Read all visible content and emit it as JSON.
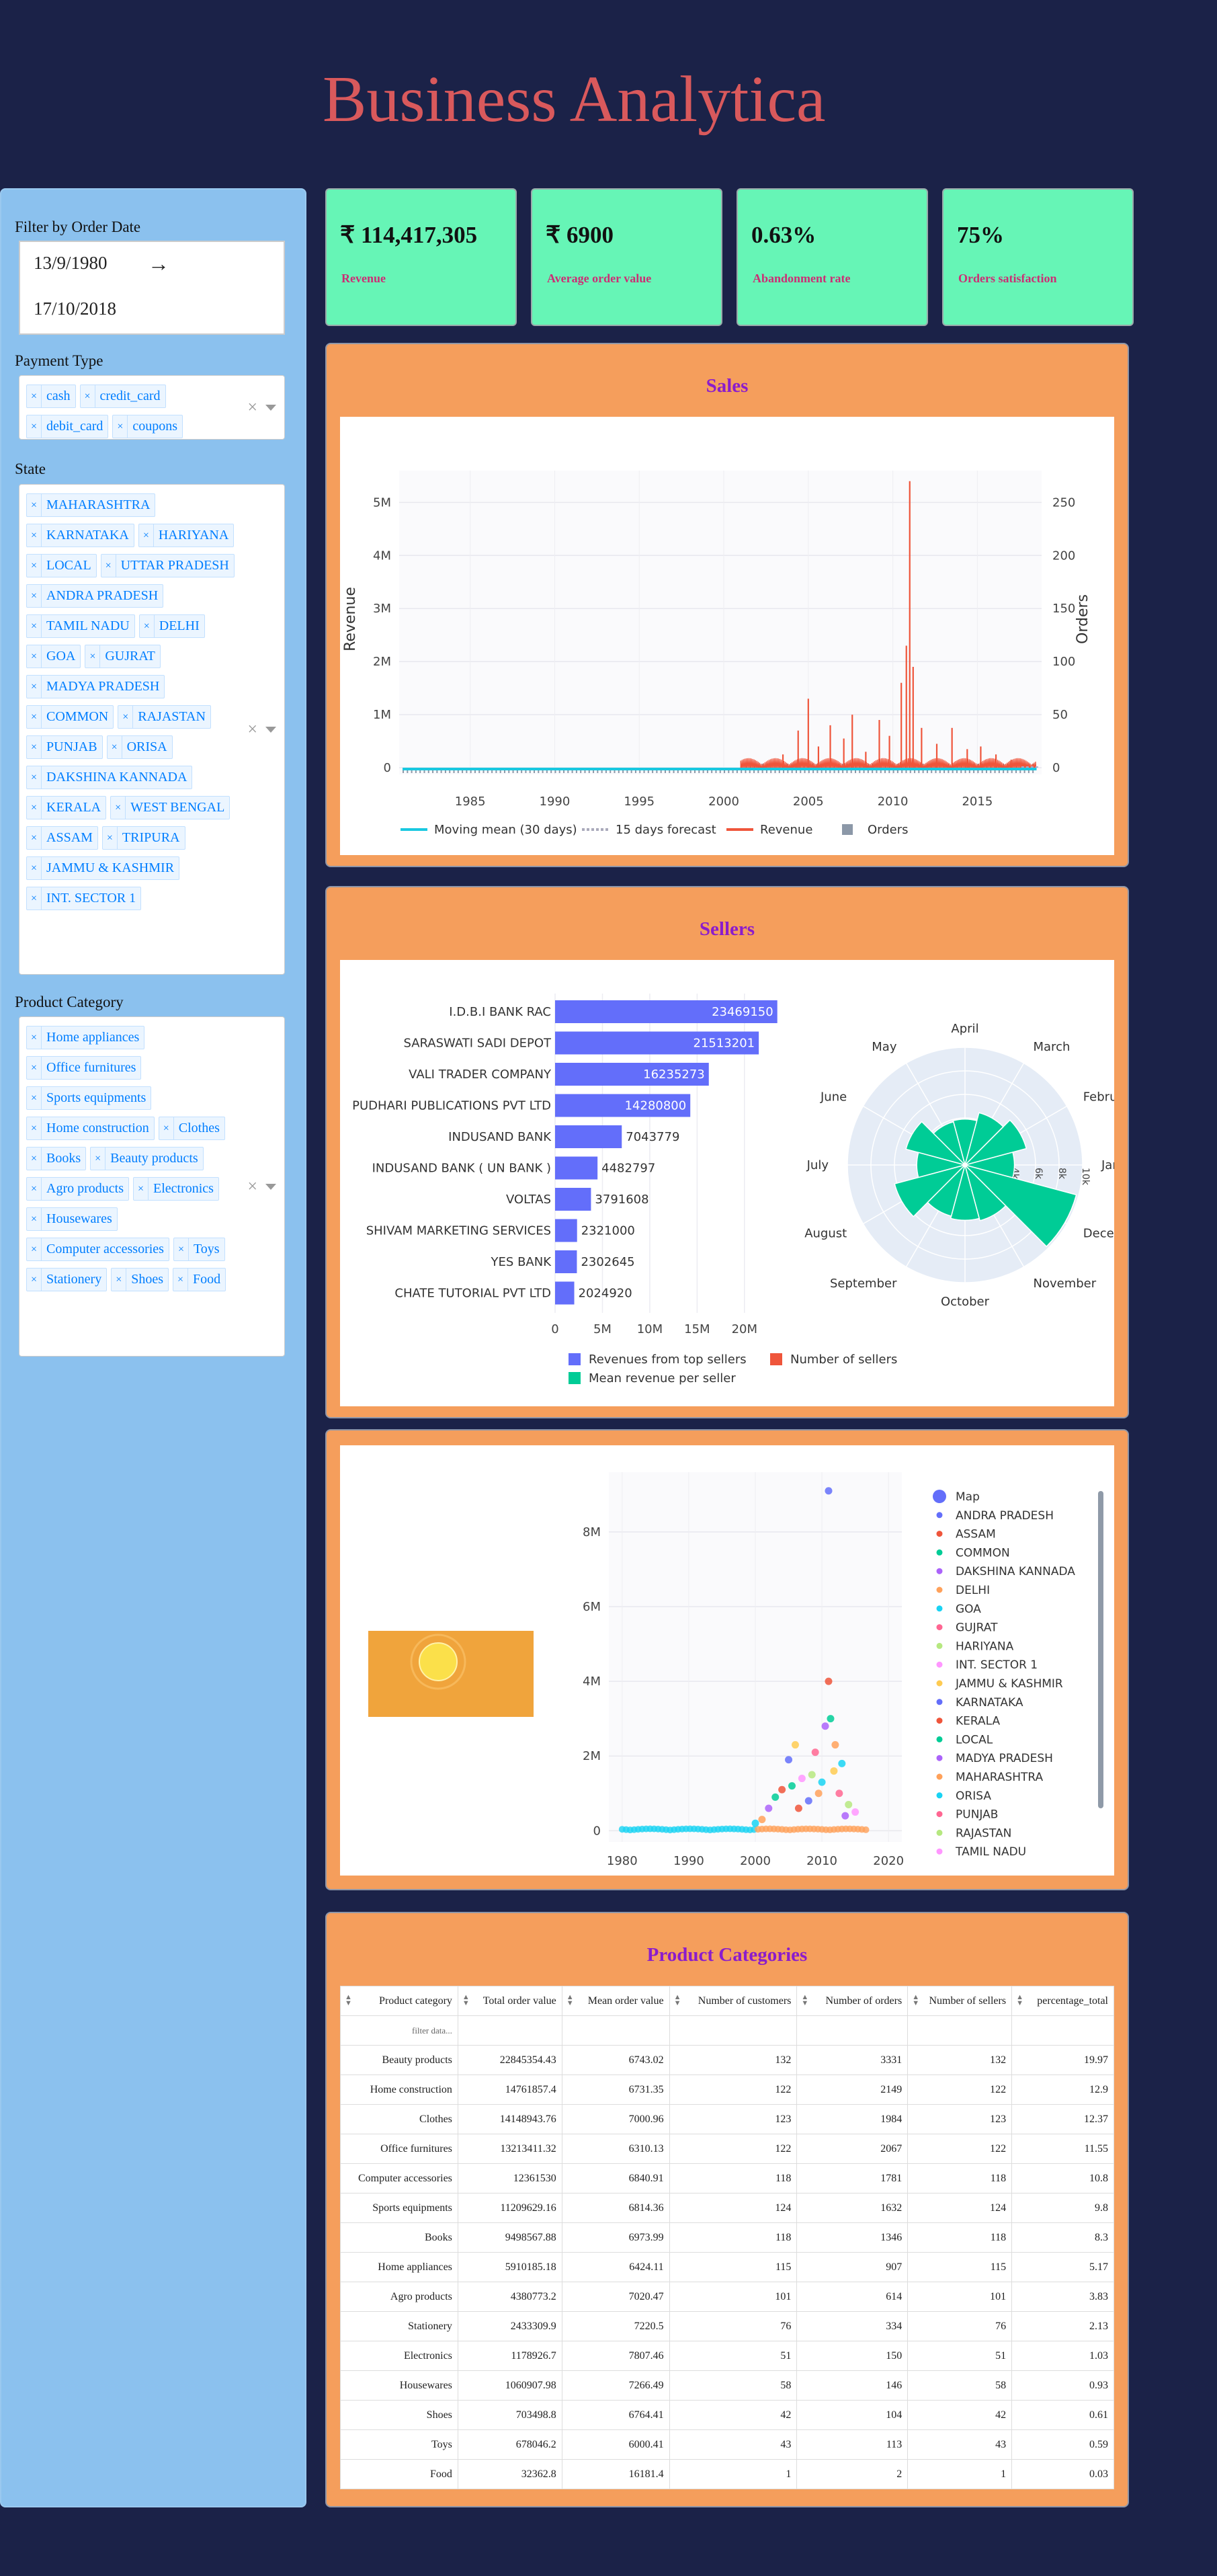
{
  "header": {
    "title": "Business Analytica"
  },
  "sidebar": {
    "date_label": "Filter by Order Date",
    "date_start": "13/9/1980",
    "date_end": "17/10/2018",
    "date_arrow": "→",
    "payment_label": "Payment Type",
    "payment_tags": [
      "cash",
      "credit_card",
      "debit_card",
      "coupons"
    ],
    "state_label": "State",
    "state_tags": [
      "MAHARASHTRA",
      "KARNATAKA",
      "HARIYANA",
      "LOCAL",
      "UTTAR PRADESH",
      "ANDRA PRADESH",
      "TAMIL NADU",
      "DELHI",
      "GOA",
      "GUJRAT",
      "MADYA PRADESH",
      "COMMON",
      "RAJASTAN",
      "PUNJAB",
      "ORISA",
      "DAKSHINA KANNADA",
      "KERALA",
      "WEST BENGAL",
      "ASSAM",
      "TRIPURA",
      "JAMMU & KASHMIR",
      "INT. SECTOR 1"
    ],
    "category_label": "Product Category",
    "category_tags": [
      "Home appliances",
      "Office furnitures",
      "Sports equipments",
      "Home construction",
      "Clothes",
      "Books",
      "Beauty products",
      "Agro products",
      "Electronics",
      "Housewares",
      "Computer accessories",
      "Toys",
      "Stationery",
      "Shoes",
      "Food"
    ],
    "remove_glyph": "×",
    "clear_glyph": "×"
  },
  "kpis": [
    {
      "value": "₹ 114,417,305",
      "label": "Revenue"
    },
    {
      "value": "₹ 6900",
      "label": "Average order value"
    },
    {
      "value": "0.63%",
      "label": "Abandonment rate"
    },
    {
      "value": "75%",
      "label": "Orders satisfaction"
    }
  ],
  "sales": {
    "title": "Sales"
  },
  "sellers": {
    "title": "Sellers"
  },
  "categories_panel": {
    "title": "Product Categories"
  },
  "colors": {
    "accent_title": "#8b1ccc",
    "panel_bg": "#f59e5c",
    "kpi_bg": "#66f5b6",
    "sidebar_bg": "#8bc1ee",
    "page_bg": "#1b2248"
  },
  "chart_data": [
    {
      "type": "line",
      "ylabel": "Revenue",
      "y2label": "Orders",
      "x_ticks": [
        "1985",
        "1990",
        "1995",
        "2000",
        "2005",
        "2010",
        "2015"
      ],
      "y_ticks": [
        "0",
        "1M",
        "2M",
        "3M",
        "4M",
        "5M"
      ],
      "y2_ticks": [
        "0",
        "50",
        "100",
        "150",
        "200",
        "250"
      ],
      "xlim": [
        1980.8,
        2018.8
      ],
      "ylim": [
        0,
        5600000
      ],
      "legend": "bottom",
      "legend_entries": [
        "Moving mean (30 days)",
        "15 days forecast",
        "Revenue",
        "Orders"
      ],
      "revenue_peaks": [
        [
          2003.5,
          250000
        ],
        [
          2004.4,
          700000
        ],
        [
          2005.0,
          1300000
        ],
        [
          2005.6,
          400000
        ],
        [
          2006.3,
          800000
        ],
        [
          2007.1,
          550000
        ],
        [
          2007.6,
          1000000
        ],
        [
          2008.4,
          300000
        ],
        [
          2009.2,
          900000
        ],
        [
          2009.8,
          600000
        ],
        [
          2010.5,
          1600000
        ],
        [
          2010.8,
          2300000
        ],
        [
          2011.0,
          5400000
        ],
        [
          2011.2,
          1900000
        ],
        [
          2011.7,
          750000
        ],
        [
          2012.6,
          450000
        ],
        [
          2013.5,
          750000
        ],
        [
          2014.4,
          350000
        ],
        [
          2015.2,
          400000
        ],
        [
          2016.1,
          250000
        ],
        [
          2017.0,
          150000
        ]
      ]
    },
    {
      "type": "bar",
      "orientation": "horizontal",
      "categories": [
        "I.D.B.I BANK RAC",
        "SARASWATI SADI DEPOT",
        "VALI TRADER COMPANY",
        "PUDHARI PUBLICATIONS PVT LTD",
        "INDUSAND BANK",
        "INDUSAND BANK ( UN BANK )",
        "VOLTAS",
        "SHIVAM MARKETING SERVICES",
        "YES BANK",
        "CHATE TUTORIAL PVT LTD"
      ],
      "values": [
        23469150,
        21513201,
        16235273,
        14280800,
        7043779,
        4482797,
        3791608,
        2321000,
        2302645,
        2024920
      ],
      "x_ticks": [
        "0",
        "5M",
        "10M",
        "15M",
        "20M"
      ],
      "xlim": [
        0,
        22000000
      ],
      "legend_entries": [
        "Revenues from top sellers",
        "Number of sellers",
        "Mean revenue per seller"
      ]
    },
    {
      "type": "polar-bar",
      "angular_labels": [
        "January",
        "February",
        "March",
        "April",
        "May",
        "June",
        "July",
        "August",
        "September",
        "October",
        "November",
        "December"
      ],
      "radial_ticks": [
        "2k",
        "4k",
        "6k",
        "8k",
        "10k"
      ],
      "values": [
        4200,
        5400,
        4600,
        3900,
        3800,
        5200,
        4100,
        6200,
        4500,
        4700,
        4900,
        9800
      ]
    },
    {
      "type": "scatter",
      "x_ticks": [
        "1980",
        "1990",
        "2000",
        "2010",
        "2020"
      ],
      "y_ticks": [
        "0",
        "2M",
        "4M",
        "6M",
        "8M"
      ],
      "xlim": [
        1978,
        2022
      ],
      "ylim": [
        -300000,
        9600000
      ],
      "legend": "right",
      "legend_entries": [
        "Map",
        "ANDRA PRADESH",
        "ASSAM",
        "COMMON",
        "DAKSHINA KANNADA",
        "DELHI",
        "GOA",
        "GUJRAT",
        "HARIYANA",
        "INT. SECTOR 1",
        "JAMMU & KASHMIR",
        "KARNATAKA",
        "KERALA",
        "LOCAL",
        "MADYA PRADESH",
        "MAHARASHTRA",
        "ORISA",
        "PUNJAB",
        "RAJASTAN",
        "TAMIL NADU"
      ],
      "points": [
        [
          2011,
          9100000
        ],
        [
          2011,
          4000000
        ],
        [
          2011.3,
          3000000
        ],
        [
          2010.5,
          2800000
        ],
        [
          2012,
          2300000
        ],
        [
          2013,
          1800000
        ],
        [
          2009,
          2100000
        ],
        [
          2008.5,
          1500000
        ],
        [
          2007,
          1400000
        ],
        [
          2006,
          2300000
        ],
        [
          2005,
          1900000
        ],
        [
          2004,
          1100000
        ],
        [
          2003,
          900000
        ],
        [
          2002,
          600000
        ],
        [
          2009.5,
          1000000
        ],
        [
          2010,
          1300000
        ],
        [
          2012.6,
          1000000
        ],
        [
          2014,
          700000
        ],
        [
          2015,
          500000
        ],
        [
          2011.8,
          1600000
        ],
        [
          2008,
          800000
        ],
        [
          2006.5,
          600000
        ],
        [
          2005.5,
          1200000
        ],
        [
          2013.5,
          400000
        ],
        [
          2001,
          300000
        ],
        [
          2000,
          200000
        ]
      ]
    },
    {
      "type": "table",
      "columns": [
        "Product category",
        "Total order value",
        "Mean order value",
        "Number of customers",
        "Number of orders",
        "Number of sellers",
        "percentage_total"
      ],
      "filter_placeholder": "filter data...",
      "rows": [
        [
          "Beauty products",
          "22845354.43",
          "6743.02",
          "132",
          "3331",
          "132",
          "19.97"
        ],
        [
          "Home construction",
          "14761857.4",
          "6731.35",
          "122",
          "2149",
          "122",
          "12.9"
        ],
        [
          "Clothes",
          "14148943.76",
          "7000.96",
          "123",
          "1984",
          "123",
          "12.37"
        ],
        [
          "Office furnitures",
          "13213411.32",
          "6310.13",
          "122",
          "2067",
          "122",
          "11.55"
        ],
        [
          "Computer accessories",
          "12361530",
          "6840.91",
          "118",
          "1781",
          "118",
          "10.8"
        ],
        [
          "Sports equipments",
          "11209629.16",
          "6814.36",
          "124",
          "1632",
          "124",
          "9.8"
        ],
        [
          "Books",
          "9498567.88",
          "6973.99",
          "118",
          "1346",
          "118",
          "8.3"
        ],
        [
          "Home appliances",
          "5910185.18",
          "6424.11",
          "115",
          "907",
          "115",
          "5.17"
        ],
        [
          "Agro products",
          "4380773.2",
          "7020.47",
          "101",
          "614",
          "101",
          "3.83"
        ],
        [
          "Stationery",
          "2433309.9",
          "7220.5",
          "76",
          "334",
          "76",
          "2.13"
        ],
        [
          "Electronics",
          "1178926.7",
          "7807.46",
          "51",
          "150",
          "51",
          "1.03"
        ],
        [
          "Housewares",
          "1060907.98",
          "7266.49",
          "58",
          "146",
          "58",
          "0.93"
        ],
        [
          "Shoes",
          "703498.8",
          "6764.41",
          "42",
          "104",
          "42",
          "0.61"
        ],
        [
          "Toys",
          "678046.2",
          "6000.41",
          "43",
          "113",
          "43",
          "0.59"
        ],
        [
          "Food",
          "32362.8",
          "16181.4",
          "1",
          "2",
          "1",
          "0.03"
        ]
      ]
    }
  ]
}
